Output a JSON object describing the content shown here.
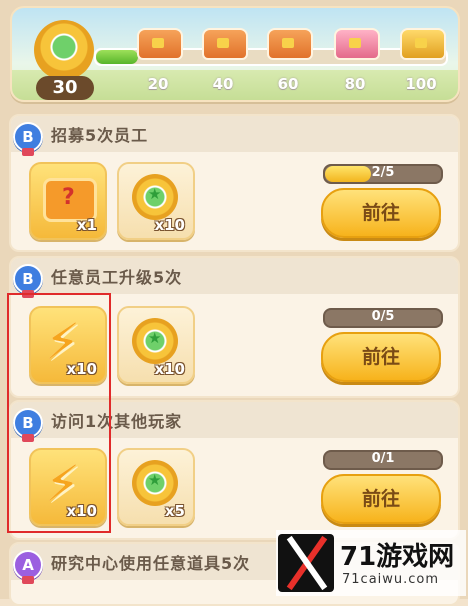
{
  "activity": {
    "points": "30",
    "progress": 0.12,
    "milestones": [
      {
        "label": "20",
        "chest": "orange-chest-icon"
      },
      {
        "label": "40",
        "chest": "orange-chest-icon"
      },
      {
        "label": "60",
        "chest": "orange-chest-icon"
      },
      {
        "label": "80",
        "chest": "pink-chest-icon"
      },
      {
        "label": "100",
        "chest": "gold-chest-icon"
      }
    ]
  },
  "tasks": [
    {
      "rank": "B",
      "title": "招募5次员工",
      "rewards": [
        {
          "icon": "recruit-ticket-icon",
          "qty": "x1"
        },
        {
          "icon": "activity-coin-icon",
          "qty": "x10"
        }
      ],
      "progress_text": "2/5",
      "progress": 0.4,
      "button": "前往"
    },
    {
      "rank": "B",
      "title": "任意员工升级5次",
      "rewards": [
        {
          "icon": "lightning-icon",
          "qty": "x10"
        },
        {
          "icon": "activity-coin-icon",
          "qty": "x10"
        }
      ],
      "progress_text": "0/5",
      "progress": 0,
      "button": "前往"
    },
    {
      "rank": "B",
      "title": "访问1次其他玩家",
      "rewards": [
        {
          "icon": "lightning-icon",
          "qty": "x10"
        },
        {
          "icon": "activity-coin-icon",
          "qty": "x5"
        }
      ],
      "progress_text": "0/1",
      "progress": 0,
      "button": "前往"
    },
    {
      "rank": "A",
      "title": "研究中心使用任意道具5次"
    }
  ],
  "watermark": {
    "brand": "71游戏网",
    "domain": "71caiwu.com"
  },
  "colors": {
    "highlight_box": "#e02a2a",
    "button": "#f7b31c",
    "rank_b": "#3f7ee0",
    "rank_a": "#9b5fe0"
  }
}
